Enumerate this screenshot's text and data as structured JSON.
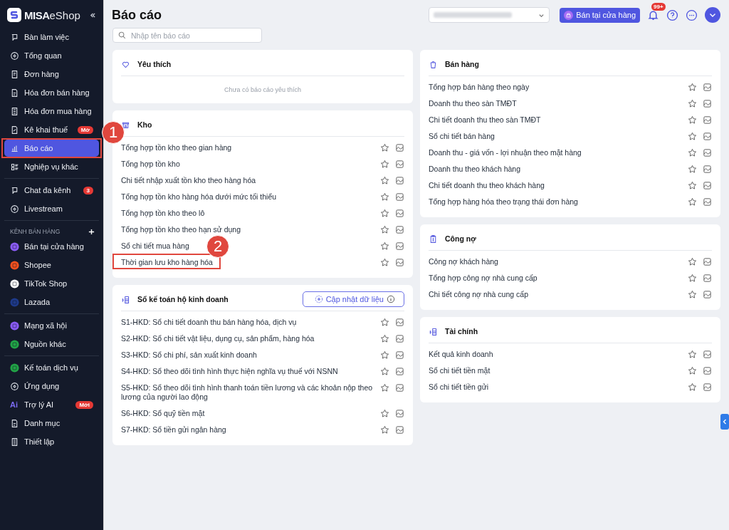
{
  "sidebar": {
    "brand": "MISA",
    "product": "eShop",
    "groups": [
      {
        "items": [
          {
            "label": "Bàn làm việc",
            "kind": "nav",
            "selected": false
          },
          {
            "label": "Tổng quan",
            "kind": "nav",
            "selected": false
          },
          {
            "label": "Đơn hàng",
            "kind": "nav",
            "selected": false
          },
          {
            "label": "Hóa đơn bán hàng",
            "kind": "nav",
            "selected": false
          },
          {
            "label": "Hóa đơn mua hàng",
            "kind": "nav",
            "selected": false
          },
          {
            "label": "Kê khai thuế",
            "kind": "nav",
            "selected": false,
            "badge": "Mớ"
          },
          {
            "label": "Báo cáo",
            "kind": "nav",
            "selected": true,
            "callout": "1"
          },
          {
            "label": "Nghiệp vụ khác",
            "kind": "nav",
            "selected": false
          }
        ]
      },
      {
        "items": [
          {
            "label": "Chat đa kênh",
            "kind": "nav",
            "selected": false,
            "badge": "3"
          },
          {
            "label": "Livestream",
            "kind": "nav",
            "selected": false
          }
        ]
      },
      {
        "heading": "KÊNH BÁN HÀNG",
        "items": [
          {
            "label": "Bán tại cửa hàng",
            "kind": "channel",
            "color": "#8b5cf6",
            "selected": false
          },
          {
            "label": "Shopee",
            "kind": "channel",
            "color": "#f4511e",
            "selected": false
          },
          {
            "label": "TikTok Shop",
            "kind": "channel",
            "color": "#ffffff",
            "selected": false
          },
          {
            "label": "Lazada",
            "kind": "channel",
            "color": "#1e3a8a",
            "selected": false
          }
        ]
      },
      {
        "items": [
          {
            "label": "Mạng xã hội",
            "kind": "channel",
            "color": "#8b5cf6",
            "selected": false
          },
          {
            "label": "Nguồn khác",
            "kind": "channel",
            "color": "#22a447",
            "selected": false
          }
        ]
      },
      {
        "items": [
          {
            "label": "Kế toán dịch vụ",
            "kind": "channel",
            "color": "#22a447",
            "selected": false
          },
          {
            "label": "Ứng dụng",
            "kind": "nav",
            "selected": false
          },
          {
            "label": "Trợ lý AI",
            "kind": "ai",
            "icon_text": "Ai",
            "selected": false,
            "badge": "Mới"
          },
          {
            "label": "Danh mục",
            "kind": "nav",
            "selected": false
          },
          {
            "label": "Thiết lập",
            "kind": "nav",
            "selected": false
          }
        ]
      }
    ]
  },
  "header": {
    "title": "Báo cáo",
    "store_button": "Bán tại cửa hàng",
    "notification_count": "99+"
  },
  "search": {
    "placeholder": "Nhập tên báo cáo"
  },
  "columns": [
    {
      "cards": [
        {
          "title": "Yêu thích",
          "empty_text": "Chưa có báo cáo yêu thích"
        },
        {
          "title": "Kho",
          "reports": [
            {
              "name": "Tổng hợp tồn kho theo gian hàng"
            },
            {
              "name": "Tổng hợp tồn kho"
            },
            {
              "name": "Chi tiết nhập xuất tồn kho theo hàng hóa"
            },
            {
              "name": "Tổng hợp tồn kho hàng hóa dưới mức tối thiểu"
            },
            {
              "name": "Tổng hợp tồn kho theo lô"
            },
            {
              "name": "Tổng hợp tồn kho theo hạn sử dụng"
            },
            {
              "name": "Sổ chi tiết mua hàng"
            },
            {
              "name": "Thời gian lưu kho hàng hóa",
              "callout": "2"
            }
          ]
        },
        {
          "title": "Sổ kế toán hộ kinh doanh",
          "action": "Cập nhật dữ liệu",
          "reports": [
            {
              "name": "S1-HKD: Sổ chi tiết doanh thu bán hàng hóa, dịch vụ"
            },
            {
              "name": "S2-HKD: Sổ chi tiết vật liệu, dụng cụ, sản phẩm, hàng hóa"
            },
            {
              "name": "S3-HKD: Sổ chi phí, sản xuất kinh doanh"
            },
            {
              "name": "S4-HKD: Sổ theo dõi tình hình thực hiện nghĩa vụ thuế với NSNN"
            },
            {
              "name": "S5-HKD: Sổ theo dõi tình hình thanh toán tiền lương và các khoản nộp theo lương của người lao động"
            },
            {
              "name": "S6-HKD: Sổ quỹ tiền mặt"
            },
            {
              "name": "S7-HKD: Sổ tiền gửi ngân hàng"
            }
          ]
        }
      ]
    },
    {
      "cards": [
        {
          "title": "Bán hàng",
          "reports": [
            {
              "name": "Tổng hợp bán hàng theo ngày"
            },
            {
              "name": "Doanh thu theo sàn TMĐT"
            },
            {
              "name": "Chi tiết doanh thu theo sàn TMĐT"
            },
            {
              "name": "Sổ chi tiết bán hàng"
            },
            {
              "name": "Doanh thu - giá vốn - lợi nhuận theo mặt hàng"
            },
            {
              "name": "Doanh thu theo khách hàng"
            },
            {
              "name": "Chi tiết doanh thu theo khách hàng"
            },
            {
              "name": "Tổng hợp hàng hóa theo trạng thái đơn hàng"
            }
          ]
        },
        {
          "title": "Công nợ",
          "reports": [
            {
              "name": "Công nợ khách hàng"
            },
            {
              "name": "Tổng hợp công nợ nhà cung cấp"
            },
            {
              "name": "Chi tiết công nợ nhà cung cấp"
            }
          ]
        },
        {
          "title": "Tài chính",
          "reports": [
            {
              "name": "Kết quả kinh doanh"
            },
            {
              "name": "Sổ chi tiết tiền mặt"
            },
            {
              "name": "Sổ chi tiết tiền gửi"
            }
          ]
        }
      ]
    }
  ]
}
